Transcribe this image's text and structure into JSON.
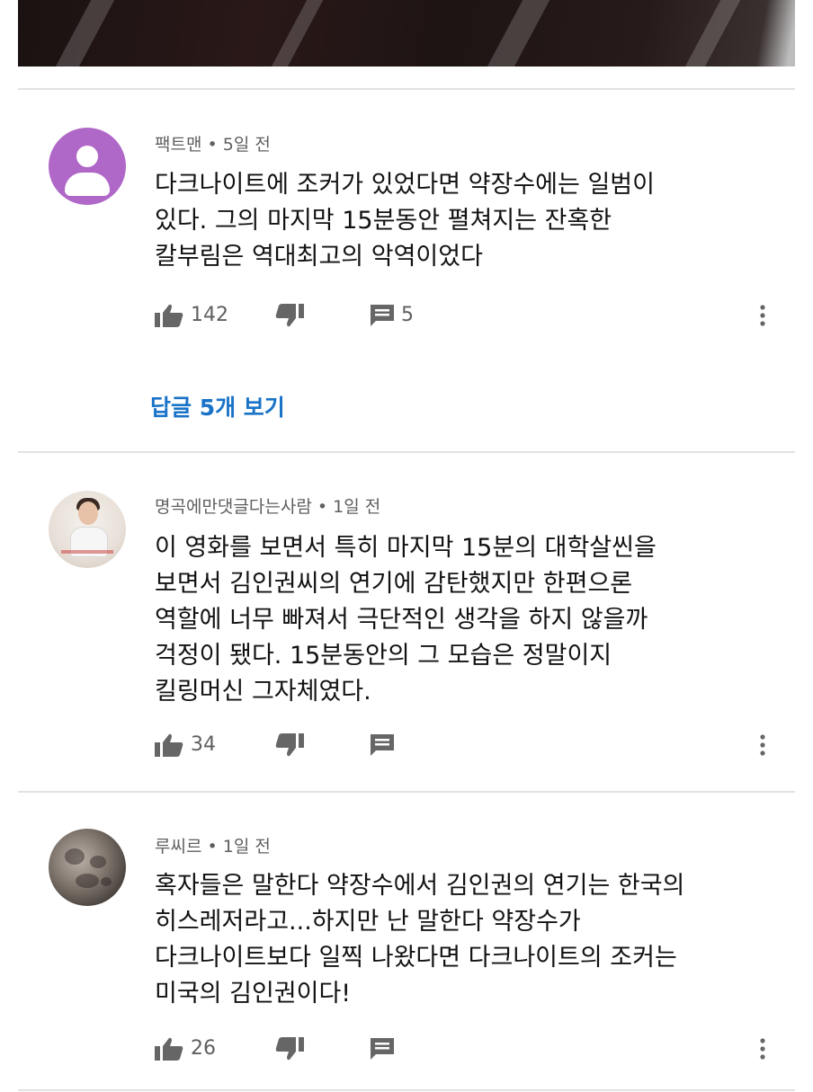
{
  "comments": [
    {
      "author": "팩트맨",
      "time": "5일 전",
      "avatar": "default-purple-user-icon",
      "avatar_color": "#b068c8",
      "lines": [
        "다크나이트에 조커가 있었다면 약장수에는 일범이",
        "있다. 그의 마지막 15분동안 펼쳐지는 잔혹한",
        "칼부림은 역대최고의 악역이었다"
      ],
      "likes": "142",
      "replies_count": "5",
      "view_replies": "답글 5개 보기"
    },
    {
      "author": "명곡에만댓글다는사람",
      "time": "1일 전",
      "avatar": "photo-avatar",
      "lines": [
        "이 영화를 보면서 특히 마지막 15분의 대학살씬을",
        "보면서 김인권씨의 연기에 감탄했지만 한편으론",
        "역할에 너무 빠져서 극단적인 생각을 하지 않을까",
        "걱정이 됐다. 15분동안의 그 모습은 정말이지",
        "킬링머신 그자체였다."
      ],
      "likes": "34"
    },
    {
      "author": "루씨르",
      "time": "1일 전",
      "avatar": "moon-avatar",
      "lines": [
        "혹자들은 말한다 약장수에서 김인권의 연기는 한국의",
        "히스레저라고...하지만 난 말한다 약장수가",
        "다크나이트보다 일찍 나왔다면 다크나이트의 조커는",
        "미국의 김인권이다!"
      ],
      "likes": "26"
    }
  ],
  "meta_separator": "•",
  "colors": {
    "link": "#1a73c8",
    "icon": "#666666",
    "divider": "#e2e2e2"
  },
  "icons": {
    "like": "thumbs-up-icon",
    "dislike": "thumbs-down-icon",
    "reply": "comment-icon",
    "more": "more-vert-icon"
  }
}
